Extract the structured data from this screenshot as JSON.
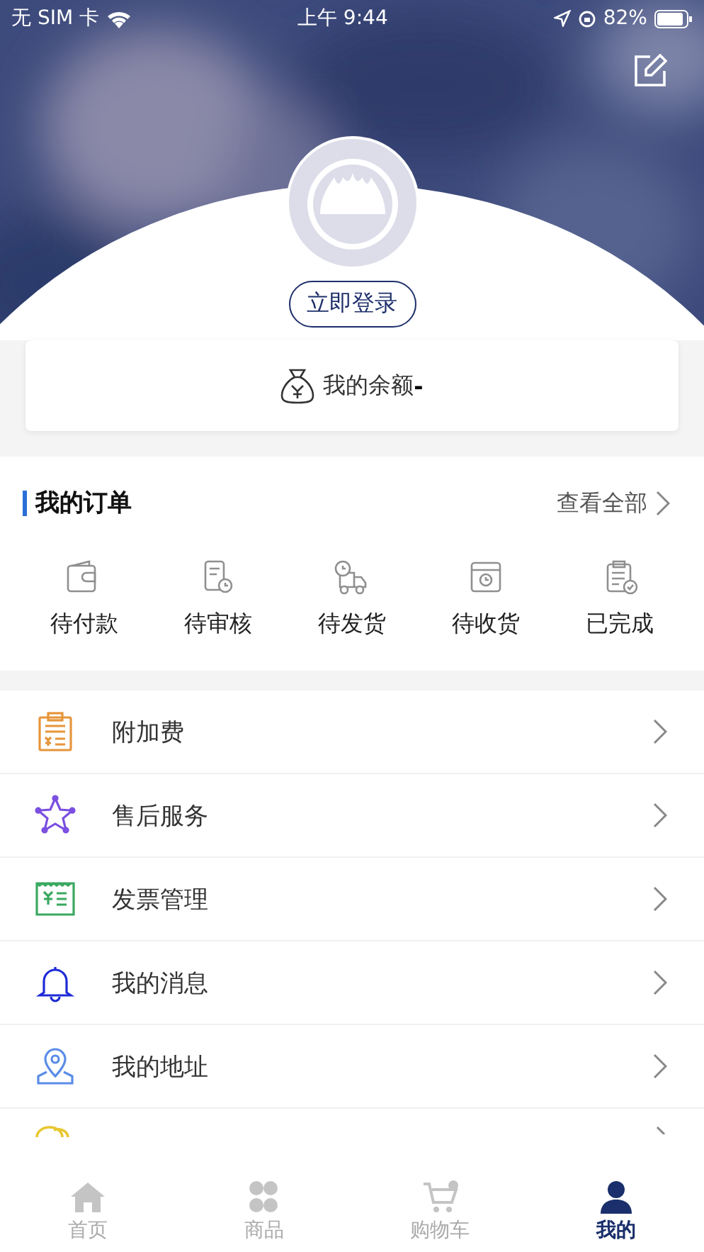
{
  "status_bar": {
    "carrier": "无 SIM 卡",
    "time": "上午 9:44",
    "battery": "82%"
  },
  "profile": {
    "login_button": "立即登录"
  },
  "balance": {
    "label": "我的余额",
    "value": "-"
  },
  "orders": {
    "title": "我的订单",
    "view_all": "查看全部",
    "items": [
      {
        "label": "待付款",
        "kind": "wallet"
      },
      {
        "label": "待审核",
        "kind": "review"
      },
      {
        "label": "待发货",
        "kind": "truck"
      },
      {
        "label": "待收货",
        "kind": "box"
      },
      {
        "label": "已完成",
        "kind": "done"
      }
    ]
  },
  "menu": [
    {
      "label": "附加费",
      "kind": "fee"
    },
    {
      "label": "售后服务",
      "kind": "star"
    },
    {
      "label": "发票管理",
      "kind": "invoice"
    },
    {
      "label": "我的消息",
      "kind": "bell"
    },
    {
      "label": "我的地址",
      "kind": "address"
    },
    {
      "kind": "contact"
    }
  ],
  "tab_bar": [
    {
      "label": "首页",
      "kind": "home",
      "selected": false
    },
    {
      "label": "商品",
      "kind": "goods",
      "selected": false
    },
    {
      "label": "购物车",
      "kind": "cart",
      "selected": false
    },
    {
      "label": "我的",
      "kind": "me",
      "selected": true
    }
  ]
}
